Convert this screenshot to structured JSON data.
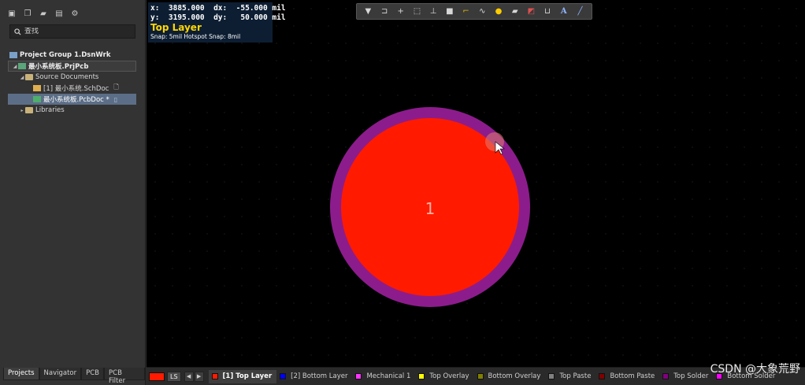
{
  "left_panel": {
    "search": {
      "placeholder": "查找"
    },
    "tree": {
      "project_group": "Project Group 1.DsnWrk",
      "project": "最小系统板.PrjPcb",
      "source_folder": "Source Documents",
      "schematic": "[1] 最小系统.SchDoc",
      "pcb_doc": "最小系统板.PcbDoc *",
      "libraries": "Libraries"
    },
    "tabs": [
      "Projects",
      "Navigator",
      "PCB",
      "PCB Filter"
    ]
  },
  "hud": {
    "line1": "x:  3885.000  dx:  -55.000 mil",
    "line2": "y:  3195.000  dy:   50.000 mil",
    "layer": "Top Layer",
    "snap": "Snap: 5mil Hotspot Snap: 8mil"
  },
  "pad": {
    "label": "1",
    "copper_color": "#ff1a00",
    "mask_color": "#8c1c8c"
  },
  "layer_bar": {
    "ls_label": "LS",
    "current_color": "#ff1a00",
    "layers": [
      {
        "name": "[1] Top Layer",
        "color": "#ff1a00",
        "active": true
      },
      {
        "name": "[2] Bottom Layer",
        "color": "#0000ff",
        "active": false
      },
      {
        "name": "Mechanical 1",
        "color": "#ff33ff",
        "active": false
      },
      {
        "name": "Top Overlay",
        "color": "#ffff00",
        "active": false
      },
      {
        "name": "Bottom Overlay",
        "color": "#808000",
        "active": false
      },
      {
        "name": "Top Paste",
        "color": "#808080",
        "active": false
      },
      {
        "name": "Bottom Paste",
        "color": "#800000",
        "active": false
      },
      {
        "name": "Top Solder",
        "color": "#800080",
        "active": false
      },
      {
        "name": "Bottom Solder",
        "color": "#ff00ff",
        "active": false
      }
    ]
  },
  "watermark": "CSDN @大象荒野"
}
